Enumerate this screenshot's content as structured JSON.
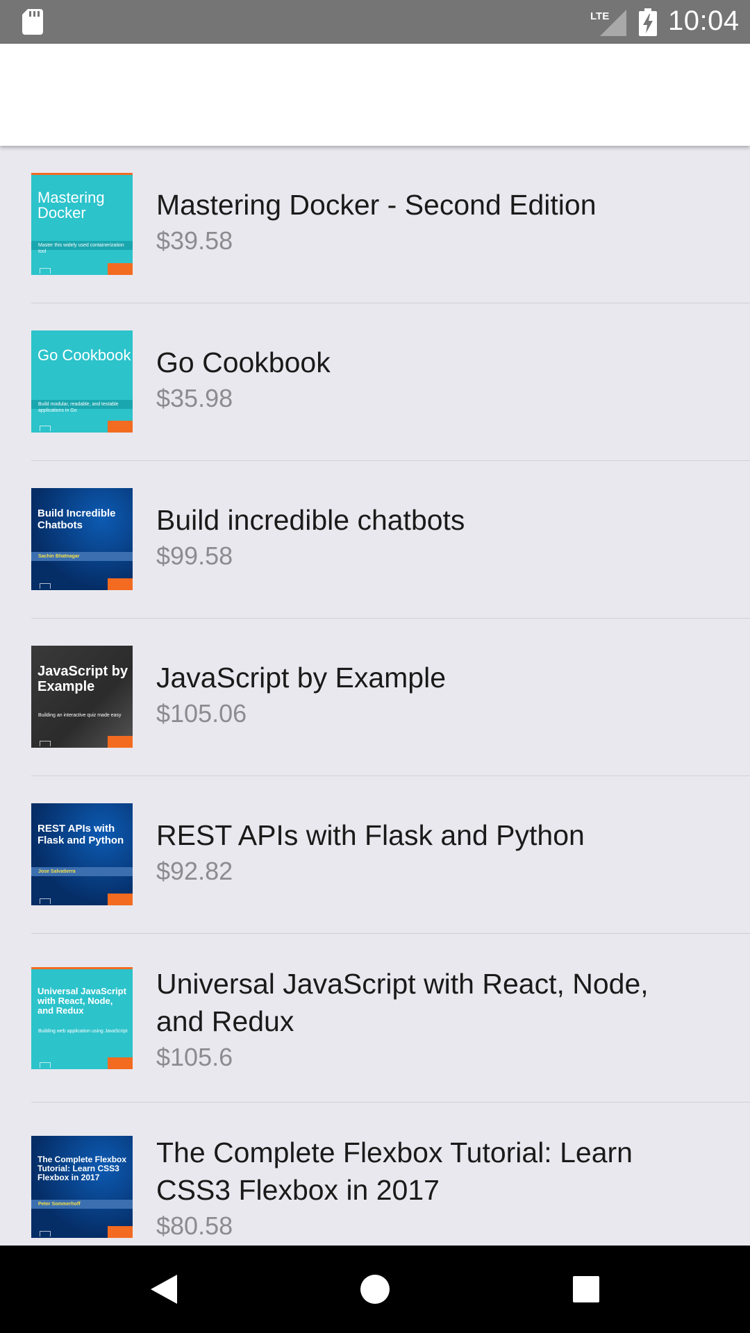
{
  "status_bar": {
    "time": "10:04",
    "network": "LTE",
    "icons": [
      "sd-card-icon",
      "lte-signal-icon",
      "battery-charging-icon"
    ]
  },
  "books": [
    {
      "title": "Mastering Docker - Second Edition",
      "price": "$39.58",
      "cover_title": "Mastering Docker",
      "cover_subtitle": "Master this widely used containerization tool",
      "cover_style": "teal"
    },
    {
      "title": "Go Cookbook",
      "price": "$35.98",
      "cover_title": "Go Cookbook",
      "cover_subtitle": "Build modular, readable, and testable applications in Go",
      "cover_style": "teal"
    },
    {
      "title": "Build incredible chatbots",
      "price": "$99.58",
      "cover_title": "Build Incredible Chatbots",
      "cover_author": "Sachin Bhatnagar",
      "cover_style": "navy"
    },
    {
      "title": "JavaScript by Example",
      "price": "$105.06",
      "cover_title": "JavaScript by Example",
      "cover_subtitle": "Building an interactive quiz made easy",
      "cover_style": "dark"
    },
    {
      "title": "REST APIs with Flask and Python",
      "price": "$92.82",
      "cover_title": "REST APIs with Flask and Python",
      "cover_author": "Jose Salvatierra",
      "cover_style": "navy"
    },
    {
      "title": "Universal JavaScript with React, Node, and Redux",
      "price": "$105.6",
      "cover_title": "Universal JavaScript with React, Node, and Redux",
      "cover_subtitle": "Building web application using JavaScript",
      "cover_style": "teal"
    },
    {
      "title": "The Complete Flexbox Tutorial: Learn CSS3 Flexbox in 2017",
      "price": "$80.58",
      "cover_title": "The Complete Flexbox Tutorial: Learn CSS3 Flexbox in 2017",
      "cover_author": "Peter Sommerhoff",
      "cover_style": "navy"
    }
  ],
  "nav_bar": {
    "buttons": [
      "back-button",
      "home-button",
      "recents-button"
    ]
  }
}
